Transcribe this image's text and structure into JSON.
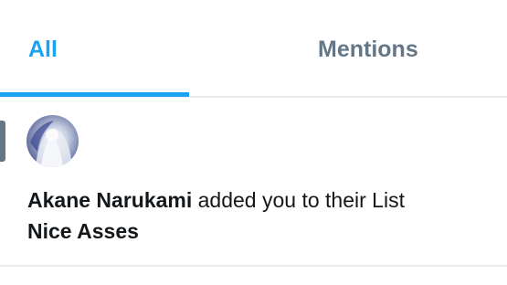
{
  "tabs": {
    "all_label": "All",
    "mentions_label": "Mentions",
    "active": "All"
  },
  "notification": {
    "actor_name": "Akane Narukami",
    "action_text": "added you to their List",
    "list_name": "Nice Asses"
  },
  "colors": {
    "accent": "#1da1f2",
    "inactive_tab": "#657786",
    "text": "#14171a",
    "divider": "#e6ecf0"
  }
}
